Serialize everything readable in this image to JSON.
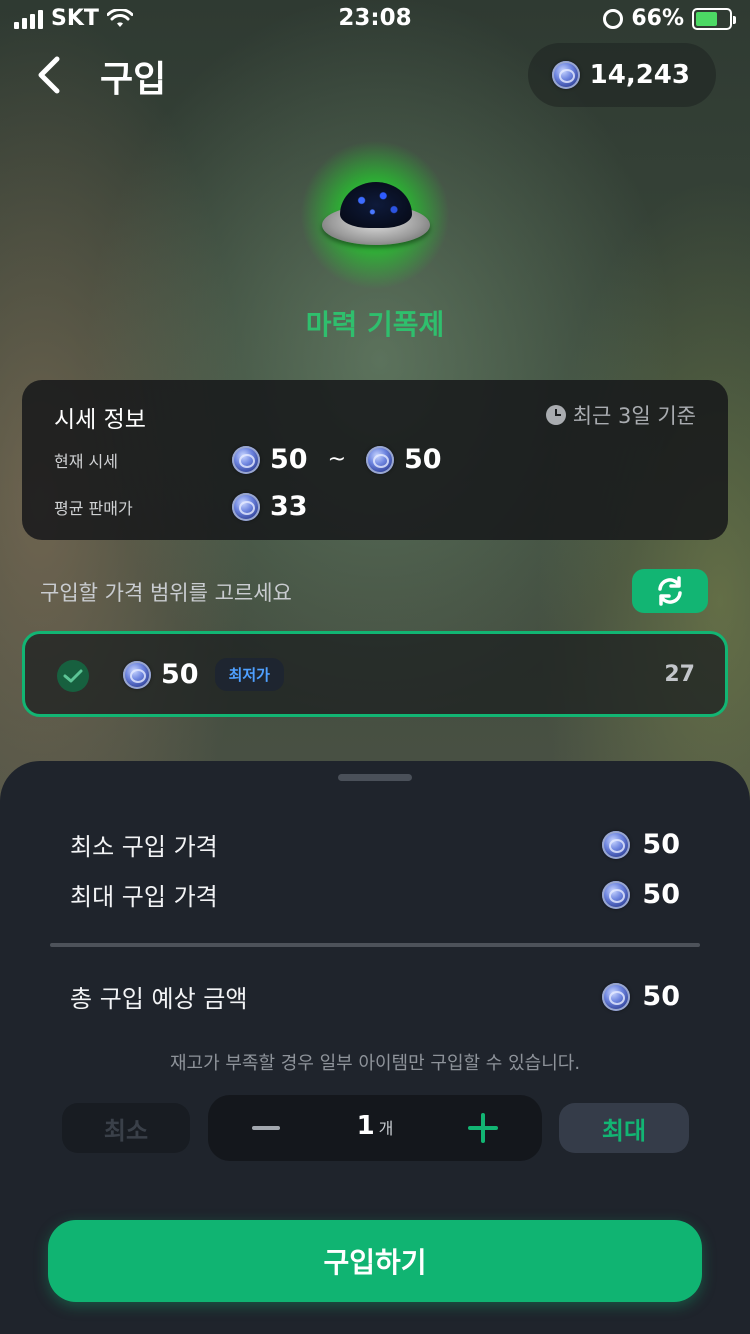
{
  "status_bar": {
    "carrier": "SKT",
    "time": "23:08",
    "battery": "66%",
    "battery_level": 0.66
  },
  "header": {
    "title": "구입",
    "back_icon": "chevron-left-icon",
    "balance": "14,243"
  },
  "item": {
    "name": "마력 기폭제",
    "name_color": "#2fbf6d"
  },
  "market_info": {
    "title": "시세 정보",
    "period": "최근 3일 기준",
    "current_label": "현재 시세",
    "current_min": "50",
    "current_tilde": "~",
    "current_max": "50",
    "average_label": "평균 판매가",
    "average_value": "33"
  },
  "range_select": {
    "prompt": "구입할 가격 범위를 고르세요",
    "options": [
      {
        "price": "50",
        "badge": "최저가",
        "quantity": "27",
        "selected": true
      }
    ]
  },
  "purchase_sheet": {
    "min_price_label": "최소 구입 가격",
    "min_price": "50",
    "max_price_label": "최대 구입 가격",
    "max_price": "50",
    "total_label": "총 구입 예상 금액",
    "total": "50",
    "notice": "재고가 부족할 경우 일부 아이템만 구입할 수 있습니다.",
    "min_button": "최소",
    "max_button": "최대",
    "quantity": "1",
    "quantity_unit": "개",
    "buy_button": "구입하기"
  },
  "colors": {
    "accent": "#12b573",
    "sheet_bg": "#1f242c",
    "badge_text": "#4fa0ff"
  }
}
